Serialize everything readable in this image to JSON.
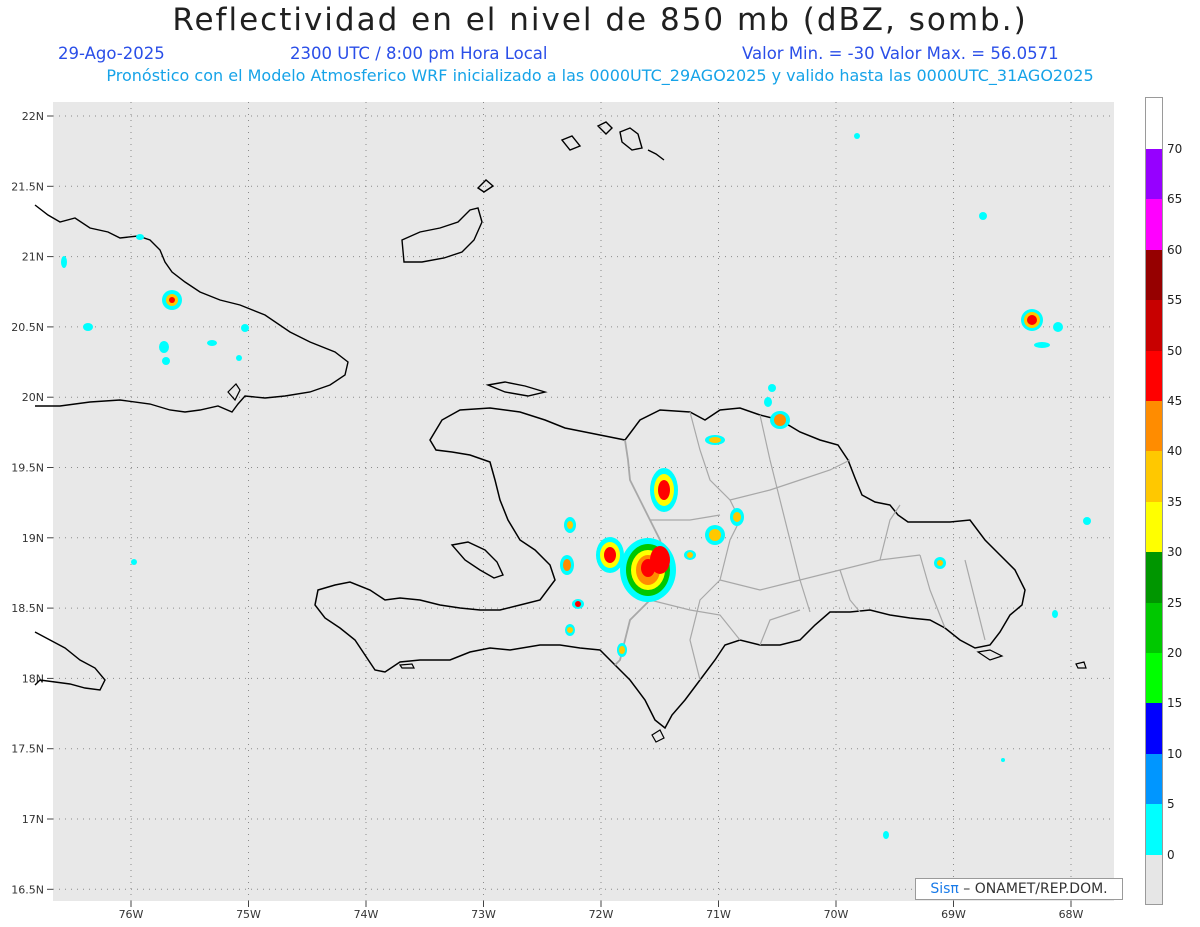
{
  "header": {
    "title": "Reflectividad en el nivel de 850 mb (dBZ, somb.)",
    "date": "29-Ago-2025",
    "time": "2300 UTC / 8:00 pm Hora Local",
    "minmax": "Valor Min. = -30  Valor Max. = 56.0571",
    "forecast": "Pronóstico con el Modelo Atmosferico WRF inicializado a las 0000UTC_29AGO2025 y valido hasta las  0000UTC_31AGO2025"
  },
  "map": {
    "lon_range": [
      -76.6,
      -67.6
    ],
    "lat_range": [
      16.4,
      22.1
    ],
    "lat_ticks": [
      "22N",
      "21.5N",
      "21N",
      "20.5N",
      "20N",
      "19.5N",
      "19N",
      "18.5N",
      "18N",
      "17.5N",
      "17N",
      "16.5N"
    ],
    "lon_ticks": [
      "76W",
      "75W",
      "74W",
      "73W",
      "72W",
      "71W",
      "70W",
      "69W",
      "68W"
    ]
  },
  "credit": {
    "brand": "Sisπ",
    "text": " – ONAMET/REP.DOM."
  },
  "colorbar": {
    "labels": [
      "0",
      "5",
      "10",
      "15",
      "20",
      "25",
      "30",
      "35",
      "40",
      "45",
      "50",
      "55",
      "60",
      "65",
      "70"
    ],
    "colors": [
      "#00ffff",
      "#0096ff",
      "#0000ff",
      "#00ff00",
      "#00c800",
      "#009600",
      "#ffff00",
      "#ffc800",
      "#ff8c00",
      "#ff0000",
      "#c80000",
      "#960000",
      "#ff00ff",
      "#9600ff"
    ]
  }
}
